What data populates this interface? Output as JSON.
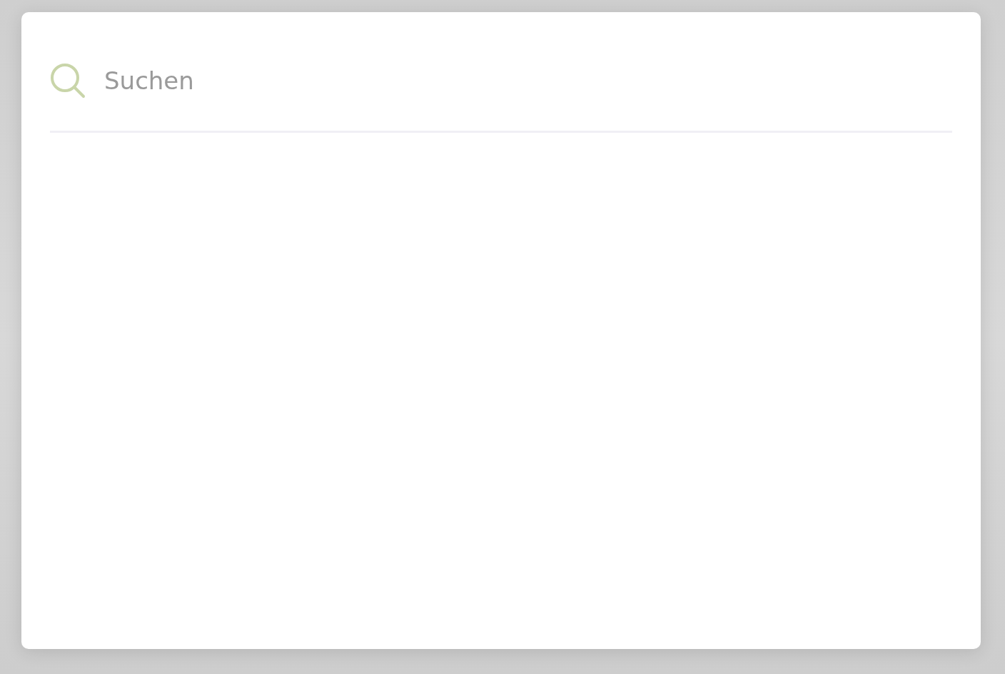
{
  "search": {
    "placeholder": "Suchen"
  }
}
